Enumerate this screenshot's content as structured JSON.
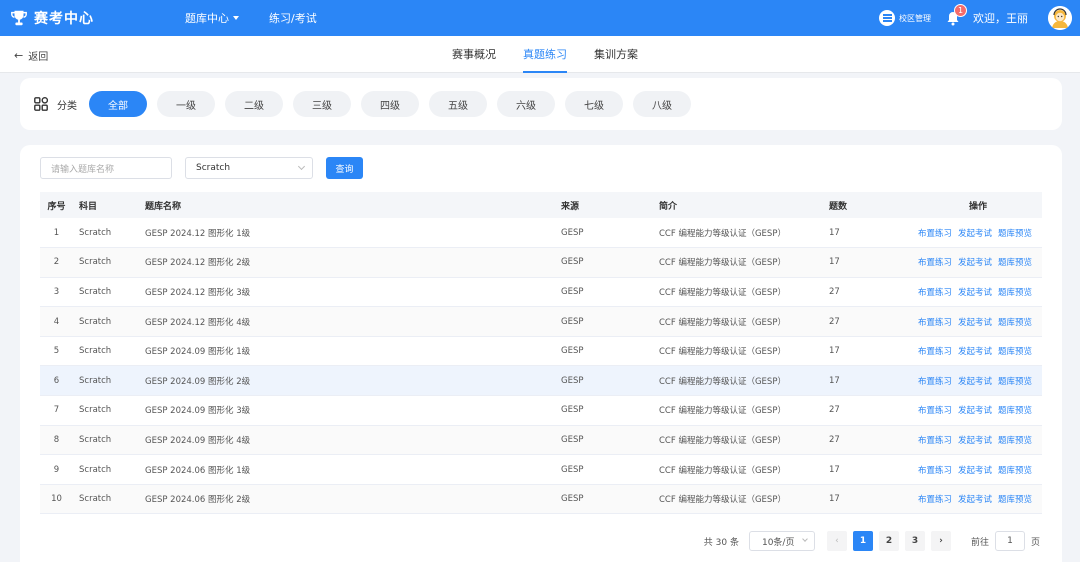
{
  "header": {
    "brand": "赛考中心",
    "nav": [
      {
        "label": "题库中心",
        "dropdown": true
      },
      {
        "label": "练习/考试",
        "dropdown": false
      }
    ],
    "campus_label": "校区管理",
    "notification_count": "1",
    "welcome": "欢迎，王丽"
  },
  "subheader": {
    "back_label": "返回",
    "tabs": [
      {
        "label": "赛事概况"
      },
      {
        "label": "真题练习",
        "active": true
      },
      {
        "label": "集训方案"
      }
    ]
  },
  "categories": {
    "label": "分类",
    "items": [
      "全部",
      "一级",
      "二级",
      "三级",
      "四级",
      "五级",
      "六级",
      "七级",
      "八级"
    ],
    "active_index": 0
  },
  "filters": {
    "search_placeholder": "请输入题库名称",
    "subject_value": "Scratch",
    "query_label": "查询"
  },
  "table": {
    "headers": {
      "index": "序号",
      "subject": "科目",
      "name": "题库名称",
      "source": "来源",
      "intro": "简介",
      "count": "题数",
      "ops": "操作"
    },
    "op_labels": [
      "布置练习",
      "发起考试",
      "题库预览"
    ],
    "rows": [
      {
        "index": "1",
        "subject": "Scratch",
        "name": "GESP 2024.12 图形化 1级",
        "source": "GESP",
        "intro": "CCF 编程能力等级认证（GESP）",
        "count": "17"
      },
      {
        "index": "2",
        "subject": "Scratch",
        "name": "GESP 2024.12 图形化 2级",
        "source": "GESP",
        "intro": "CCF 编程能力等级认证（GESP）",
        "count": "17"
      },
      {
        "index": "3",
        "subject": "Scratch",
        "name": "GESP 2024.12 图形化 3级",
        "source": "GESP",
        "intro": "CCF 编程能力等级认证（GESP）",
        "count": "27"
      },
      {
        "index": "4",
        "subject": "Scratch",
        "name": "GESP 2024.12 图形化 4级",
        "source": "GESP",
        "intro": "CCF 编程能力等级认证（GESP）",
        "count": "27"
      },
      {
        "index": "5",
        "subject": "Scratch",
        "name": "GESP 2024.09 图形化 1级",
        "source": "GESP",
        "intro": "CCF 编程能力等级认证（GESP）",
        "count": "17"
      },
      {
        "index": "6",
        "subject": "Scratch",
        "name": "GESP 2024.09 图形化 2级",
        "source": "GESP",
        "intro": "CCF 编程能力等级认证（GESP）",
        "count": "17"
      },
      {
        "index": "7",
        "subject": "Scratch",
        "name": "GESP 2024.09 图形化 3级",
        "source": "GESP",
        "intro": "CCF 编程能力等级认证（GESP）",
        "count": "27"
      },
      {
        "index": "8",
        "subject": "Scratch",
        "name": "GESP 2024.09 图形化 4级",
        "source": "GESP",
        "intro": "CCF 编程能力等级认证（GESP）",
        "count": "27"
      },
      {
        "index": "9",
        "subject": "Scratch",
        "name": "GESP 2024.06 图形化 1级",
        "source": "GESP",
        "intro": "CCF 编程能力等级认证（GESP）",
        "count": "17"
      },
      {
        "index": "10",
        "subject": "Scratch",
        "name": "GESP 2024.06 图形化 2级",
        "source": "GESP",
        "intro": "CCF 编程能力等级认证（GESP）",
        "count": "17"
      }
    ],
    "highlighted_row": 5
  },
  "pagination": {
    "total": "共 30 条",
    "page_size": "10条/页",
    "pages": [
      "1",
      "2",
      "3"
    ],
    "current": "1",
    "prev": "‹",
    "next": "›",
    "goto_label": "前往",
    "goto_value": "1",
    "goto_suffix": "页"
  },
  "colors": {
    "accent": "#2b86f6",
    "badge": "#f56c6c"
  }
}
